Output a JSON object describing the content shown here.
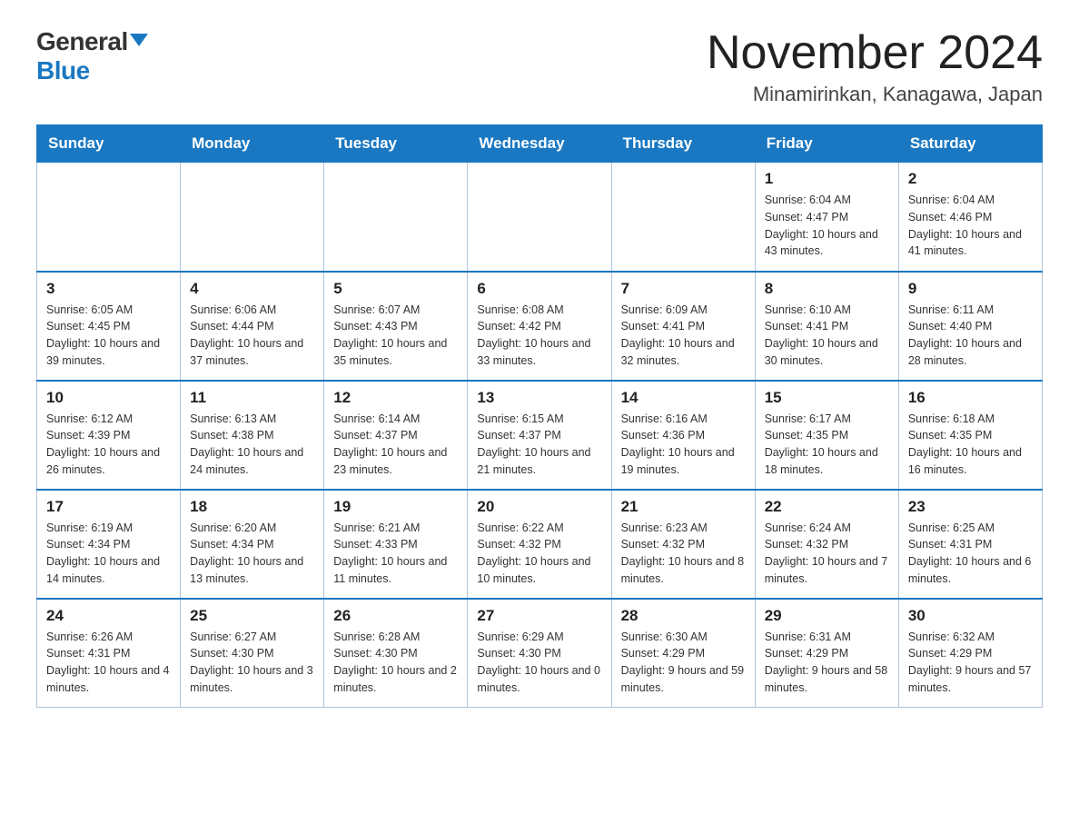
{
  "header": {
    "logo_general": "General",
    "logo_blue": "Blue",
    "month_title": "November 2024",
    "location": "Minamirinkan, Kanagawa, Japan"
  },
  "weekdays": [
    "Sunday",
    "Monday",
    "Tuesday",
    "Wednesday",
    "Thursday",
    "Friday",
    "Saturday"
  ],
  "weeks": [
    [
      {
        "day": "",
        "sunrise": "",
        "sunset": "",
        "daylight": ""
      },
      {
        "day": "",
        "sunrise": "",
        "sunset": "",
        "daylight": ""
      },
      {
        "day": "",
        "sunrise": "",
        "sunset": "",
        "daylight": ""
      },
      {
        "day": "",
        "sunrise": "",
        "sunset": "",
        "daylight": ""
      },
      {
        "day": "",
        "sunrise": "",
        "sunset": "",
        "daylight": ""
      },
      {
        "day": "1",
        "sunrise": "Sunrise: 6:04 AM",
        "sunset": "Sunset: 4:47 PM",
        "daylight": "Daylight: 10 hours and 43 minutes."
      },
      {
        "day": "2",
        "sunrise": "Sunrise: 6:04 AM",
        "sunset": "Sunset: 4:46 PM",
        "daylight": "Daylight: 10 hours and 41 minutes."
      }
    ],
    [
      {
        "day": "3",
        "sunrise": "Sunrise: 6:05 AM",
        "sunset": "Sunset: 4:45 PM",
        "daylight": "Daylight: 10 hours and 39 minutes."
      },
      {
        "day": "4",
        "sunrise": "Sunrise: 6:06 AM",
        "sunset": "Sunset: 4:44 PM",
        "daylight": "Daylight: 10 hours and 37 minutes."
      },
      {
        "day": "5",
        "sunrise": "Sunrise: 6:07 AM",
        "sunset": "Sunset: 4:43 PM",
        "daylight": "Daylight: 10 hours and 35 minutes."
      },
      {
        "day": "6",
        "sunrise": "Sunrise: 6:08 AM",
        "sunset": "Sunset: 4:42 PM",
        "daylight": "Daylight: 10 hours and 33 minutes."
      },
      {
        "day": "7",
        "sunrise": "Sunrise: 6:09 AM",
        "sunset": "Sunset: 4:41 PM",
        "daylight": "Daylight: 10 hours and 32 minutes."
      },
      {
        "day": "8",
        "sunrise": "Sunrise: 6:10 AM",
        "sunset": "Sunset: 4:41 PM",
        "daylight": "Daylight: 10 hours and 30 minutes."
      },
      {
        "day": "9",
        "sunrise": "Sunrise: 6:11 AM",
        "sunset": "Sunset: 4:40 PM",
        "daylight": "Daylight: 10 hours and 28 minutes."
      }
    ],
    [
      {
        "day": "10",
        "sunrise": "Sunrise: 6:12 AM",
        "sunset": "Sunset: 4:39 PM",
        "daylight": "Daylight: 10 hours and 26 minutes."
      },
      {
        "day": "11",
        "sunrise": "Sunrise: 6:13 AM",
        "sunset": "Sunset: 4:38 PM",
        "daylight": "Daylight: 10 hours and 24 minutes."
      },
      {
        "day": "12",
        "sunrise": "Sunrise: 6:14 AM",
        "sunset": "Sunset: 4:37 PM",
        "daylight": "Daylight: 10 hours and 23 minutes."
      },
      {
        "day": "13",
        "sunrise": "Sunrise: 6:15 AM",
        "sunset": "Sunset: 4:37 PM",
        "daylight": "Daylight: 10 hours and 21 minutes."
      },
      {
        "day": "14",
        "sunrise": "Sunrise: 6:16 AM",
        "sunset": "Sunset: 4:36 PM",
        "daylight": "Daylight: 10 hours and 19 minutes."
      },
      {
        "day": "15",
        "sunrise": "Sunrise: 6:17 AM",
        "sunset": "Sunset: 4:35 PM",
        "daylight": "Daylight: 10 hours and 18 minutes."
      },
      {
        "day": "16",
        "sunrise": "Sunrise: 6:18 AM",
        "sunset": "Sunset: 4:35 PM",
        "daylight": "Daylight: 10 hours and 16 minutes."
      }
    ],
    [
      {
        "day": "17",
        "sunrise": "Sunrise: 6:19 AM",
        "sunset": "Sunset: 4:34 PM",
        "daylight": "Daylight: 10 hours and 14 minutes."
      },
      {
        "day": "18",
        "sunrise": "Sunrise: 6:20 AM",
        "sunset": "Sunset: 4:34 PM",
        "daylight": "Daylight: 10 hours and 13 minutes."
      },
      {
        "day": "19",
        "sunrise": "Sunrise: 6:21 AM",
        "sunset": "Sunset: 4:33 PM",
        "daylight": "Daylight: 10 hours and 11 minutes."
      },
      {
        "day": "20",
        "sunrise": "Sunrise: 6:22 AM",
        "sunset": "Sunset: 4:32 PM",
        "daylight": "Daylight: 10 hours and 10 minutes."
      },
      {
        "day": "21",
        "sunrise": "Sunrise: 6:23 AM",
        "sunset": "Sunset: 4:32 PM",
        "daylight": "Daylight: 10 hours and 8 minutes."
      },
      {
        "day": "22",
        "sunrise": "Sunrise: 6:24 AM",
        "sunset": "Sunset: 4:32 PM",
        "daylight": "Daylight: 10 hours and 7 minutes."
      },
      {
        "day": "23",
        "sunrise": "Sunrise: 6:25 AM",
        "sunset": "Sunset: 4:31 PM",
        "daylight": "Daylight: 10 hours and 6 minutes."
      }
    ],
    [
      {
        "day": "24",
        "sunrise": "Sunrise: 6:26 AM",
        "sunset": "Sunset: 4:31 PM",
        "daylight": "Daylight: 10 hours and 4 minutes."
      },
      {
        "day": "25",
        "sunrise": "Sunrise: 6:27 AM",
        "sunset": "Sunset: 4:30 PM",
        "daylight": "Daylight: 10 hours and 3 minutes."
      },
      {
        "day": "26",
        "sunrise": "Sunrise: 6:28 AM",
        "sunset": "Sunset: 4:30 PM",
        "daylight": "Daylight: 10 hours and 2 minutes."
      },
      {
        "day": "27",
        "sunrise": "Sunrise: 6:29 AM",
        "sunset": "Sunset: 4:30 PM",
        "daylight": "Daylight: 10 hours and 0 minutes."
      },
      {
        "day": "28",
        "sunrise": "Sunrise: 6:30 AM",
        "sunset": "Sunset: 4:29 PM",
        "daylight": "Daylight: 9 hours and 59 minutes."
      },
      {
        "day": "29",
        "sunrise": "Sunrise: 6:31 AM",
        "sunset": "Sunset: 4:29 PM",
        "daylight": "Daylight: 9 hours and 58 minutes."
      },
      {
        "day": "30",
        "sunrise": "Sunrise: 6:32 AM",
        "sunset": "Sunset: 4:29 PM",
        "daylight": "Daylight: 9 hours and 57 minutes."
      }
    ]
  ]
}
